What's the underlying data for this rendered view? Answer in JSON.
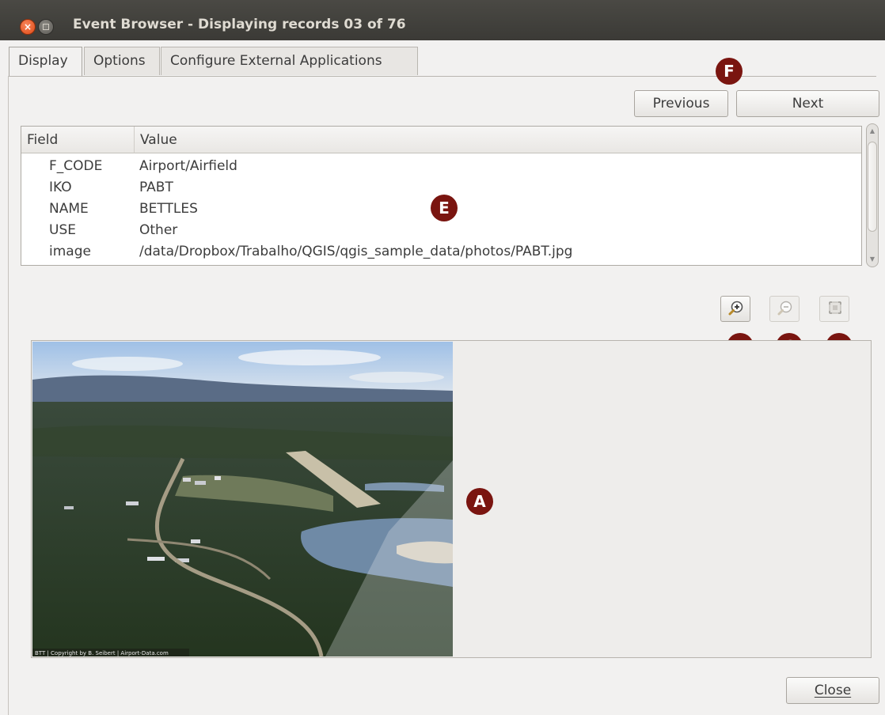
{
  "window": {
    "title": "Event Browser - Displaying records 03 of 76",
    "close_glyph": "×"
  },
  "tabs": [
    {
      "label": "Display"
    },
    {
      "label": "Options"
    },
    {
      "label": "Configure External Applications"
    }
  ],
  "nav": {
    "previous_label": "Previous",
    "next_label": "Next"
  },
  "attribute_table": {
    "headers": {
      "field": "Field",
      "value": "Value"
    },
    "rows": [
      {
        "field": "F_CODE",
        "value": "Airport/Airfield"
      },
      {
        "field": "IKO",
        "value": "PABT"
      },
      {
        "field": "NAME",
        "value": "BETTLES"
      },
      {
        "field": "USE",
        "value": "Other"
      },
      {
        "field": "image",
        "value": "/data/Dropbox/Trabalho/QGIS/qgis_sample_data/photos/PABT.jpg"
      }
    ]
  },
  "zoom_tools": [
    {
      "name": "zoom-in-icon",
      "enabled": true
    },
    {
      "name": "zoom-out-icon",
      "enabled": false
    },
    {
      "name": "zoom-to-full-extent-icon",
      "enabled": false
    }
  ],
  "photo": {
    "caption": "BTT | Copyright by B. Seibert | Airport-Data.com"
  },
  "markers": {
    "a": "A",
    "b": "B",
    "c": "C",
    "d": "D",
    "e": "E",
    "f": "F"
  },
  "footer": {
    "close_label": "Close"
  },
  "colors": {
    "marker": "#7a1510",
    "window_background": "#f2f1f0",
    "titlebar": "#3f3e3a"
  }
}
